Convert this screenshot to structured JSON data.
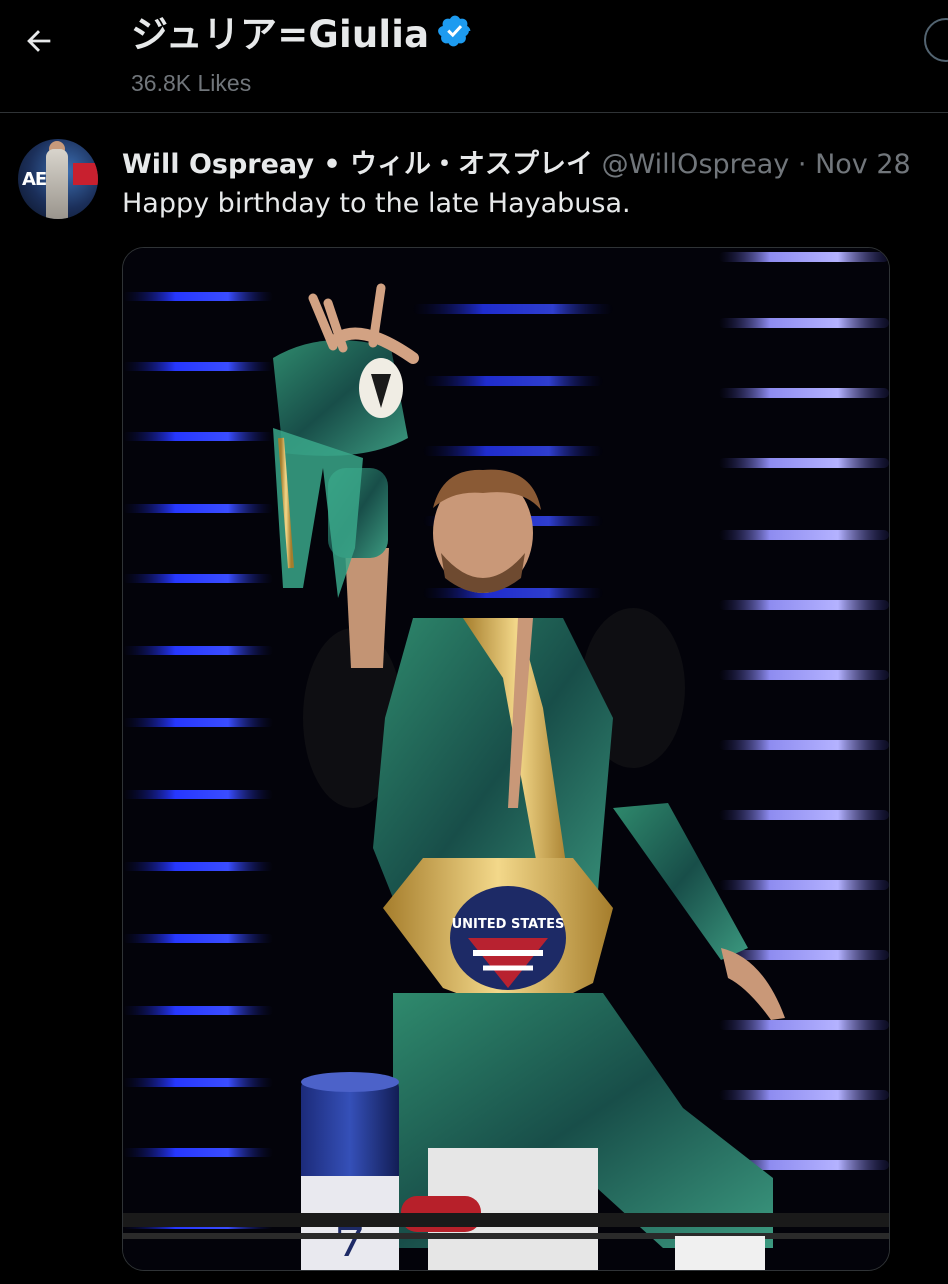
{
  "header": {
    "title": "ジュリア=Giulia",
    "subtitle": "36.8K Likes",
    "back_icon": "arrow-left-icon",
    "verified_icon": "verified-badge-icon"
  },
  "tweet": {
    "display_name": "Will Ospreay • ウィル・オスプレイ",
    "handle": "@WillOspreay",
    "separator": "·",
    "timestamp": "Nov 28",
    "text": "Happy birthday to the late Hayabusa.",
    "media": {
      "type": "photo",
      "belt_text": "UNITED STATES"
    }
  },
  "colors": {
    "background": "#000000",
    "text_primary": "#e7e9ea",
    "text_secondary": "#71767b",
    "border": "#2f3336",
    "verified_blue": "#1d9bf0"
  }
}
